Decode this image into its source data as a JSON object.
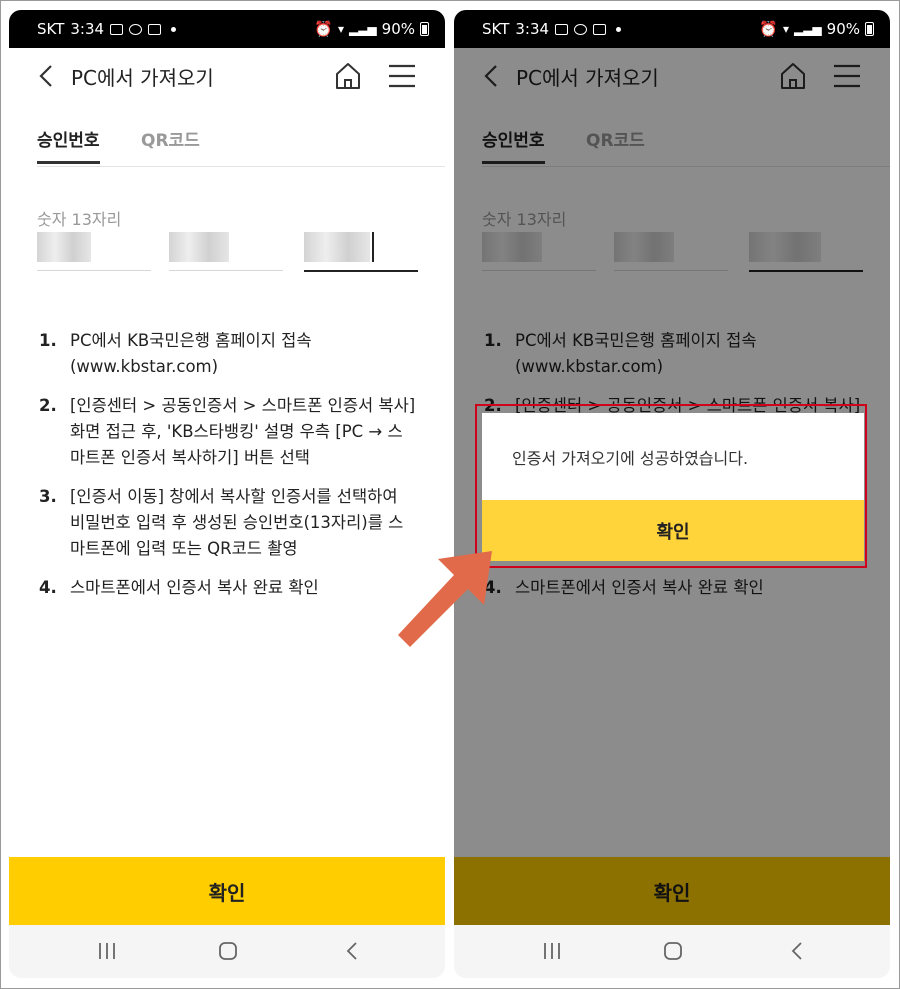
{
  "status": {
    "carrier": "SKT",
    "time": "3:34",
    "battery": "90%"
  },
  "header": {
    "title": "PC에서 가져오기"
  },
  "tabs": [
    {
      "label": "승인번호",
      "active": true
    },
    {
      "label": "QR코드",
      "active": false
    }
  ],
  "form": {
    "label": "숫자 13자리"
  },
  "steps": [
    {
      "num": "1.",
      "lines": [
        "PC에서 KB국민은행 홈페이지 접속",
        "(www.kbstar.com)"
      ]
    },
    {
      "num": "2.",
      "lines": [
        "[인증센터 > 공동인증서 > 스마트폰 인증서 복사]",
        "화면 접근 후, 'KB스타뱅킹' 설명 우측 [PC → 스",
        "마트폰 인증서 복사하기] 버튼 선택"
      ]
    },
    {
      "num": "3.",
      "lines": [
        "[인증서 이동] 창에서 복사할 인증서를 선택하여",
        "비밀번호 입력 후 생성된 승인번호(13자리)를 스",
        "마트폰에 입력 또는 QR코드 촬영"
      ]
    },
    {
      "num": "4.",
      "lines": [
        "스마트폰에서 인증서 복사 완료 확인"
      ]
    }
  ],
  "confirm_label": "확인",
  "dialog": {
    "message": "인증서 가져오기에 성공하였습니다.",
    "ok_label": "확인"
  },
  "colors": {
    "brand_yellow": "#ffcd00",
    "highlight": "#d0021b",
    "arrow": "#e06a4a"
  }
}
